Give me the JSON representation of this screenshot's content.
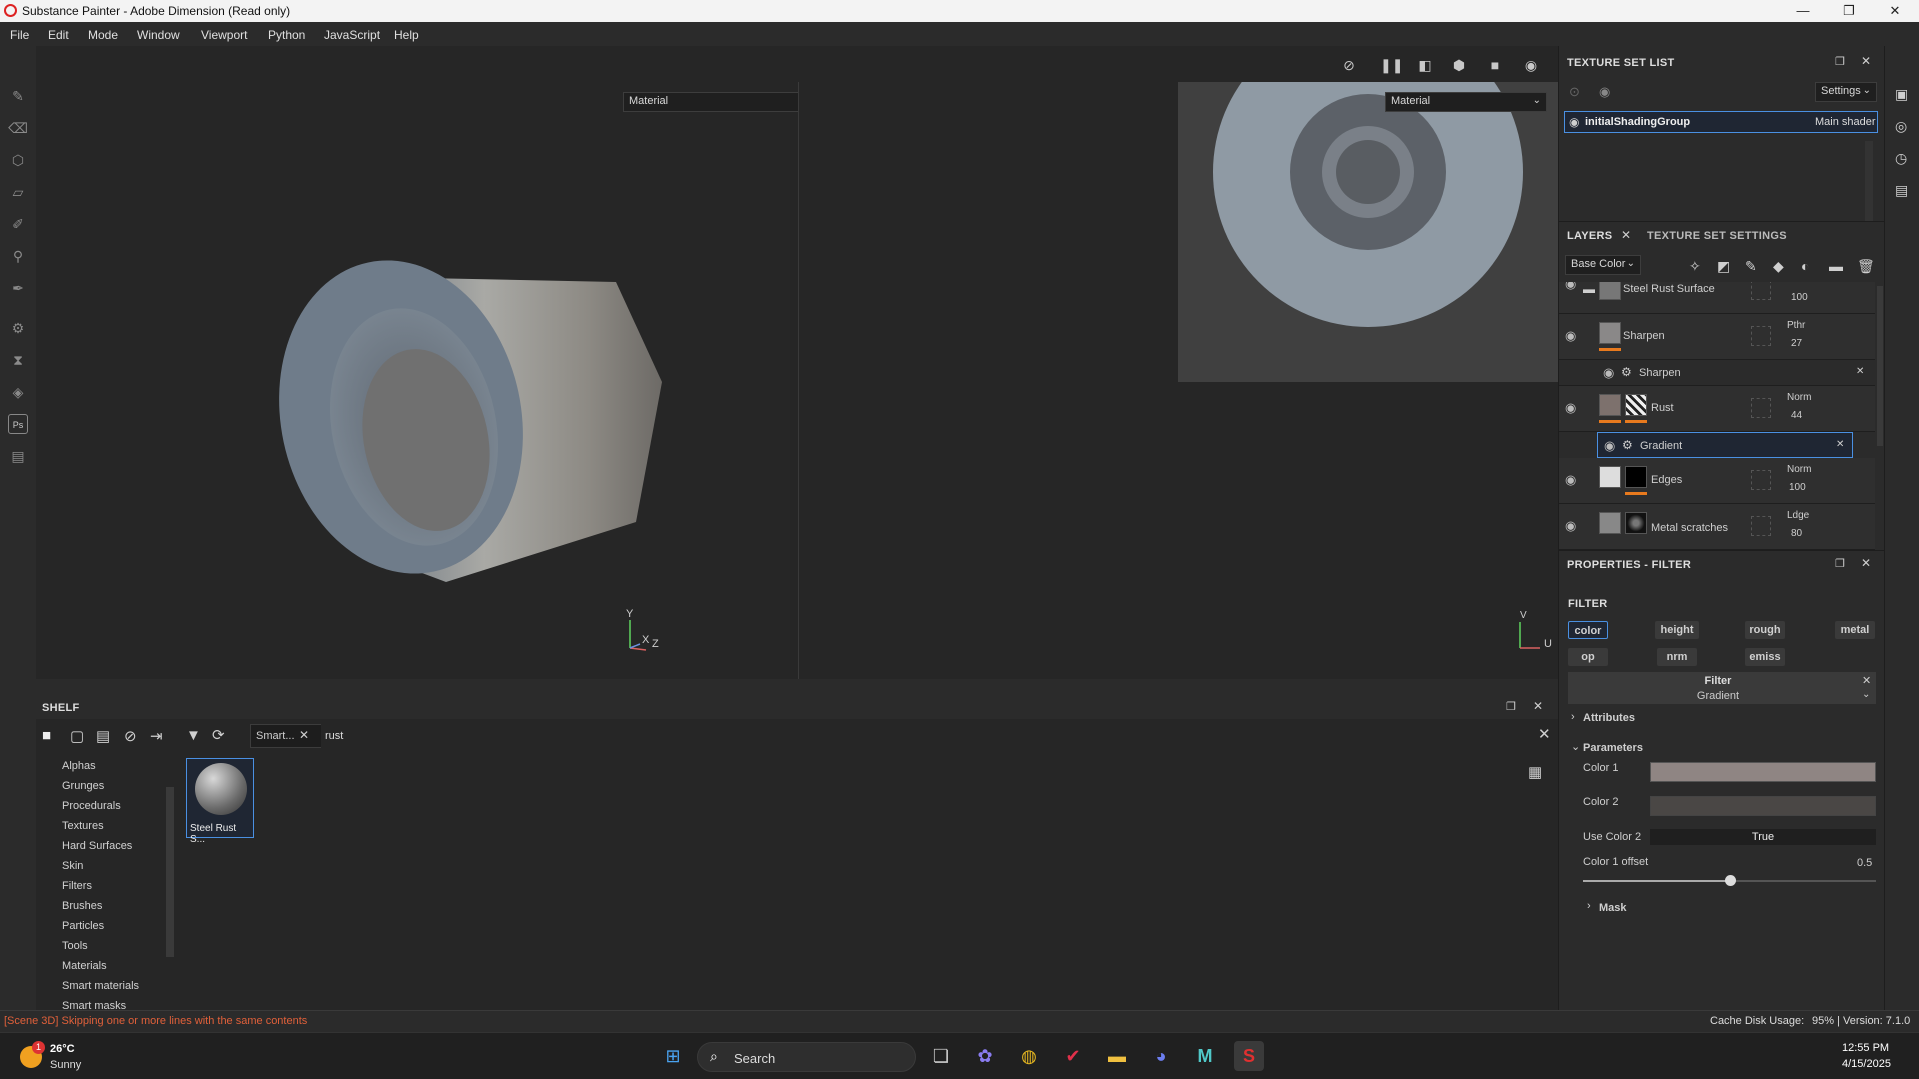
{
  "window": {
    "title": "Substance Painter - Adobe Dimension (Read only)",
    "controls": [
      "—",
      "❐",
      "✕"
    ]
  },
  "menu": [
    "File",
    "Edit",
    "Mode",
    "Window",
    "Viewport",
    "Python",
    "JavaScript",
    "Help"
  ],
  "viewport": {
    "left_dropdown": "Material",
    "right_dropdown": "Material",
    "axis3d": {
      "y": "Y",
      "x": "X",
      "z": "Z"
    },
    "axis2d": {
      "v": "V",
      "u": "U"
    }
  },
  "texture_set_list": {
    "title": "TEXTURE SET LIST",
    "settings": "Settings",
    "item_name": "initialShadingGroup",
    "item_shader": "Main shader"
  },
  "layers": {
    "tab_layers": "LAYERS",
    "tab_settings": "TEXTURE SET SETTINGS",
    "channel": "Base Color",
    "rows": [
      {
        "name": "Steel Rust Surface",
        "blend": "",
        "opacity": "100"
      },
      {
        "name": "Sharpen",
        "blend": "Pthr",
        "opacity": "27"
      },
      {
        "name": "Sharpen",
        "blend": "",
        "opacity": ""
      },
      {
        "name": "Rust",
        "blend": "Norm",
        "opacity": "44"
      },
      {
        "name": "Gradient",
        "blend": "",
        "opacity": ""
      },
      {
        "name": "Edges",
        "blend": "Norm",
        "opacity": "100"
      },
      {
        "name": "Metal scratches",
        "blend": "Ldge",
        "opacity": "80"
      }
    ]
  },
  "properties": {
    "title": "PROPERTIES - FILTER",
    "section": "FILTER",
    "channels": [
      "color",
      "height",
      "rough",
      "metal",
      "op",
      "nrm",
      "emiss"
    ],
    "filter_label": "Filter",
    "filter_value": "Gradient",
    "attributes": "Attributes",
    "parameters": "Parameters",
    "color1_label": "Color 1",
    "color2_label": "Color 2",
    "use_color2_label": "Use Color 2",
    "use_color2_value": "True",
    "color1_offset_label": "Color 1 offset",
    "color1_offset_value": "0.5",
    "color1_offset": 0.5,
    "mask": "Mask",
    "color1": "#8f8583",
    "color2": "#4a4745"
  },
  "shelf": {
    "title": "SHELF",
    "filter_tag": "Smart...",
    "search": "rust",
    "categories": [
      "Alphas",
      "Grunges",
      "Procedurals",
      "Textures",
      "Hard Surfaces",
      "Skin",
      "Filters",
      "Brushes",
      "Particles",
      "Tools",
      "Materials",
      "Smart materials",
      "Smart masks"
    ],
    "item_label": "Steel Rust S..."
  },
  "status": {
    "log": "[Scene 3D] Skipping one or more lines with the same contents",
    "cache": "Cache Disk Usage:",
    "cache_value": "95% | Version: 7.1.0"
  },
  "taskbar": {
    "weather_temp": "26°C",
    "weather_desc": "Sunny",
    "weather_badge": "1",
    "search": "Search",
    "time": "12:55 PM",
    "date": "4/15/2025"
  },
  "colors": {
    "accent": "#4a90e2",
    "orange": "#e87a1e",
    "log_error": "#e0603a"
  }
}
